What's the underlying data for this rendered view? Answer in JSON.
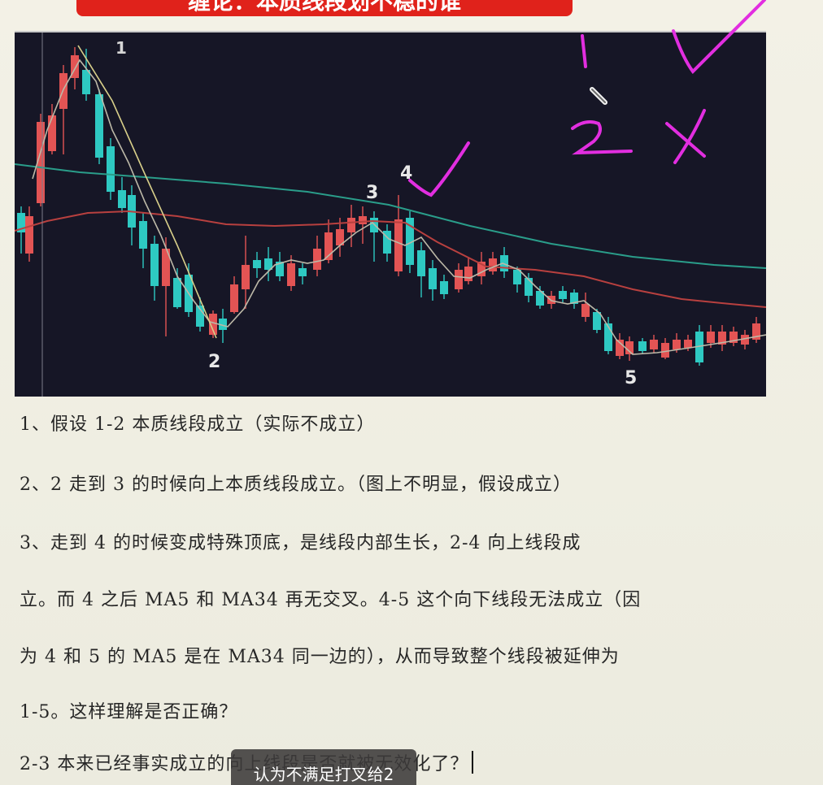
{
  "banner": {
    "title": "缠论：本质线段划不稳的谁"
  },
  "chart": {
    "point_labels": [
      "1",
      "2",
      "3",
      "4",
      "5"
    ],
    "colors": {
      "up": "#e35454",
      "down": "#2ec9c2",
      "ma_teal": "#2a9d8a",
      "ma_red": "#b8403f",
      "ma_gray": "#bdb9a8",
      "background": "#161626"
    }
  },
  "annotations": {
    "color": "#e22ee0",
    "marks": [
      "1",
      "2",
      "check",
      "cross",
      "check"
    ]
  },
  "text": {
    "lines": [
      "1、假设 1-2 本质线段成立（实际不成立）",
      "2、2 走到 3 的时候向上本质线段成立。（图上不明显，假设成立）",
      "3、走到 4 的时候变成特殊顶底，是线段内部生长，2-4 向上线段成",
      "立。而 4 之后 MA5 和 MA34 再无交叉。4-5 这个向下线段无法成立（因",
      "为 4 和 5 的 MA5 是在 MA34 同一边的），从而导致整个线段被延伸为",
      "1-5。这样理解是否正确？",
      "2-3 本来已经事实成立的向上线段是否就被无效化了？"
    ]
  },
  "caption": {
    "text": "认为不满足打叉给2"
  }
}
